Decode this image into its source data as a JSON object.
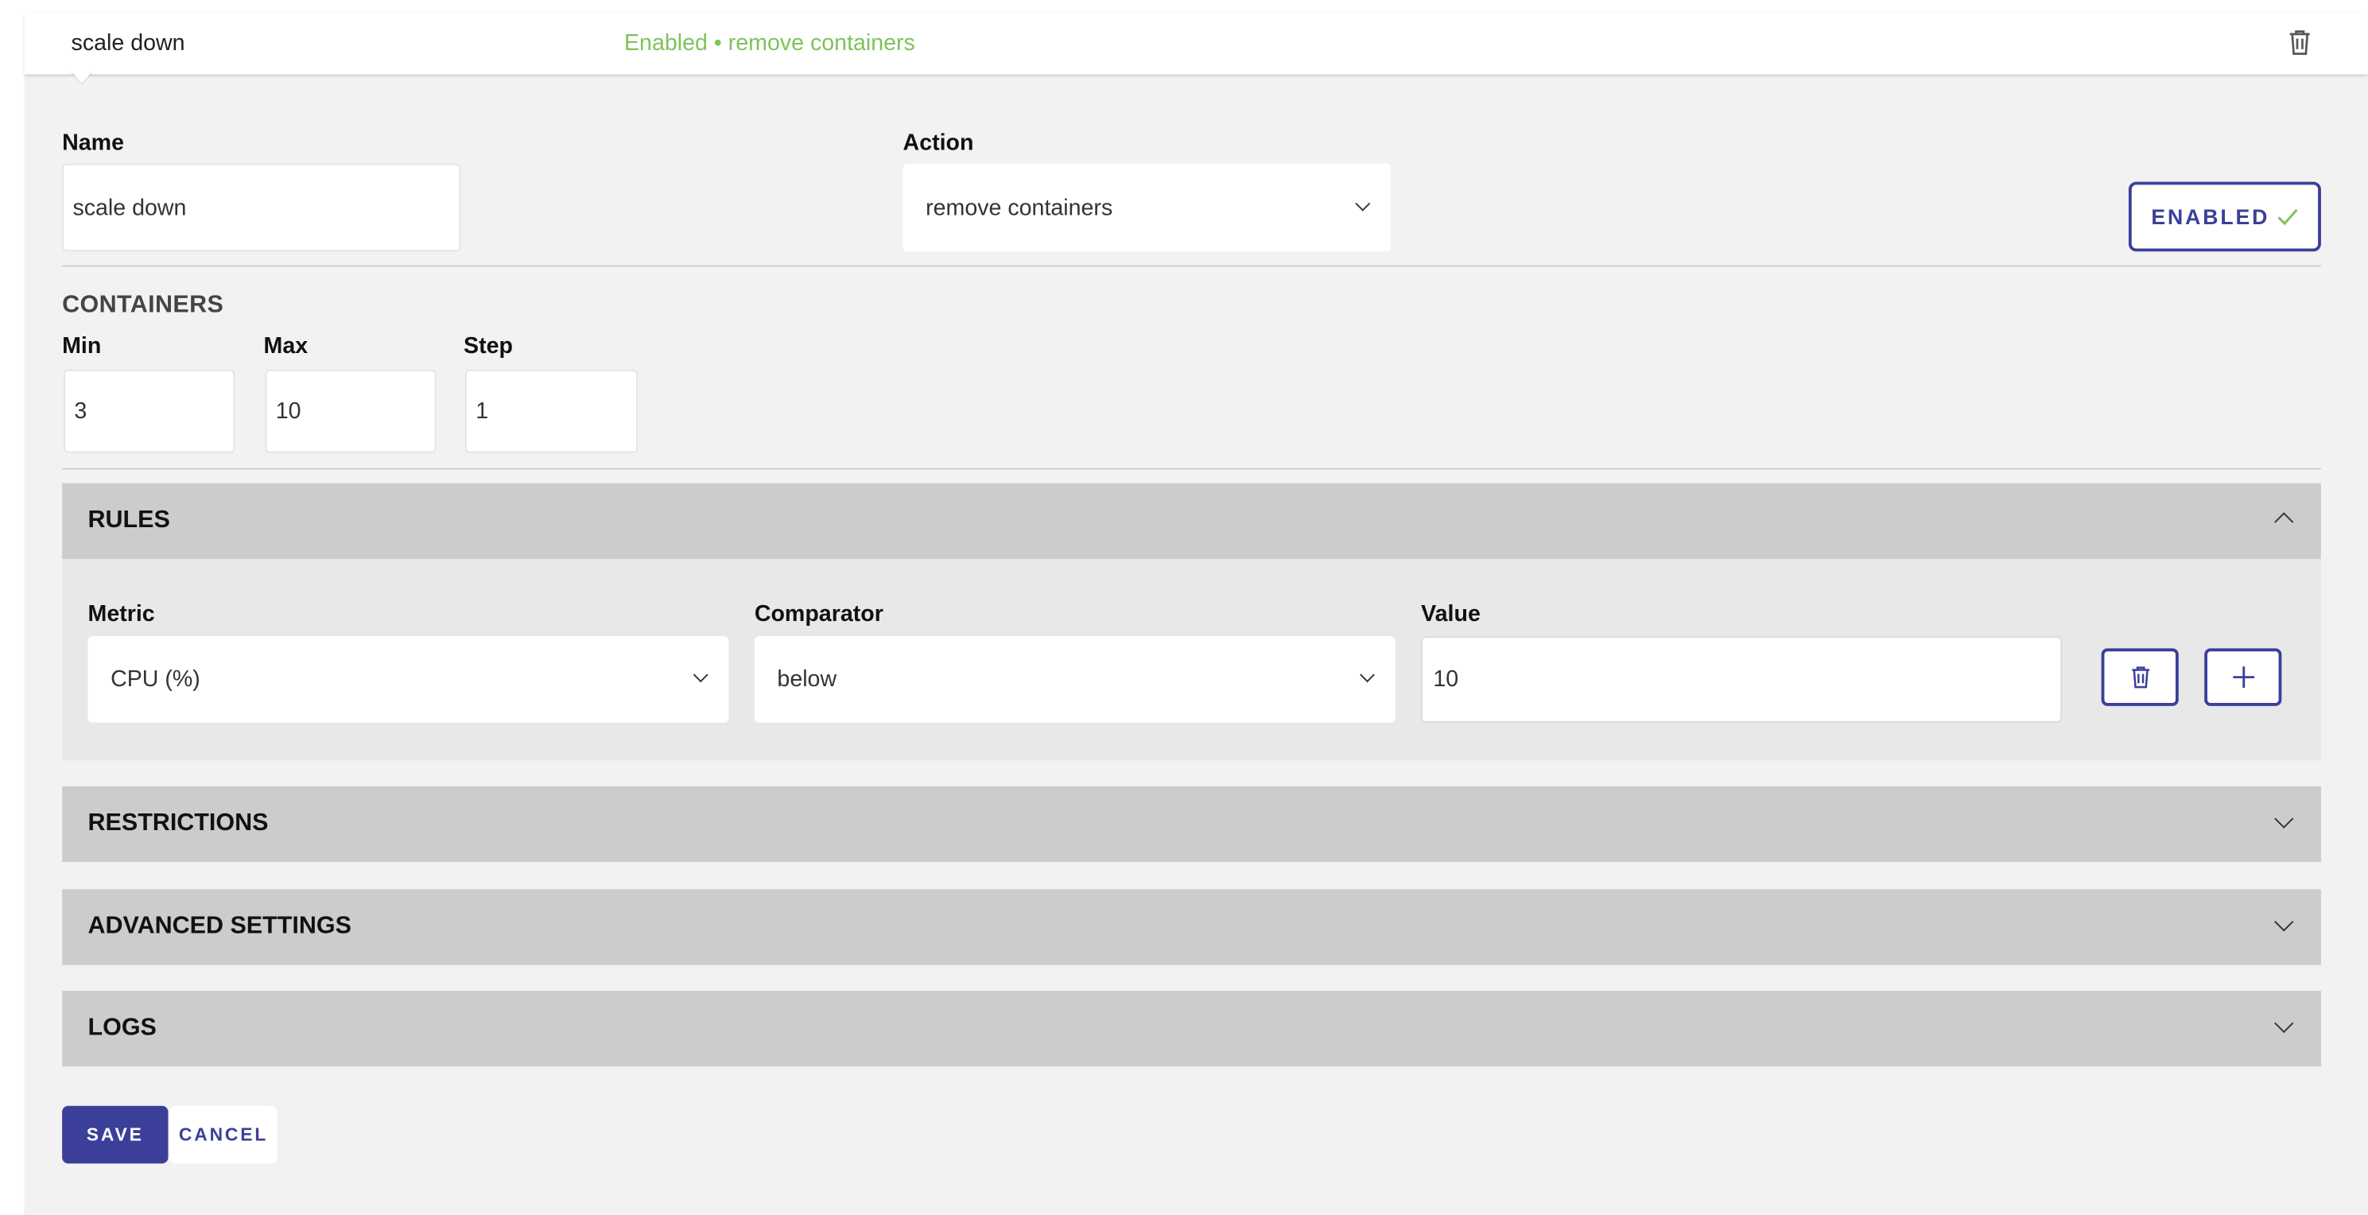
{
  "header": {
    "title": "scale down",
    "status": "Enabled • remove containers",
    "delete_icon": "trash-icon",
    "status_color": "#7fc25a"
  },
  "form": {
    "name_label": "Name",
    "name_value": "scale down",
    "action_label": "Action",
    "action_value": "remove containers",
    "enabled_label": "ENABLED",
    "enabled_icon": "check-icon"
  },
  "containers": {
    "title": "CONTAINERS",
    "min_label": "Min",
    "min_value": "3",
    "max_label": "Max",
    "max_value": "10",
    "step_label": "Step",
    "step_value": "1"
  },
  "rules": {
    "title": "RULES",
    "expanded": true,
    "metric_label": "Metric",
    "metric_value": "CPU (%)",
    "comparator_label": "Comparator",
    "comparator_value": "below",
    "value_label": "Value",
    "value_value": "10",
    "delete_icon": "trash-icon",
    "add_icon": "plus-icon"
  },
  "sections": {
    "restrictions": "RESTRICTIONS",
    "advanced": "ADVANCED SETTINGS",
    "logs": "LOGS"
  },
  "actions": {
    "save_label": "SAVE",
    "cancel_label": "CANCEL"
  },
  "colors": {
    "accent": "#3b3f9a",
    "panel_bg": "#f2f2f2",
    "accordion_bg": "#cccccc"
  }
}
